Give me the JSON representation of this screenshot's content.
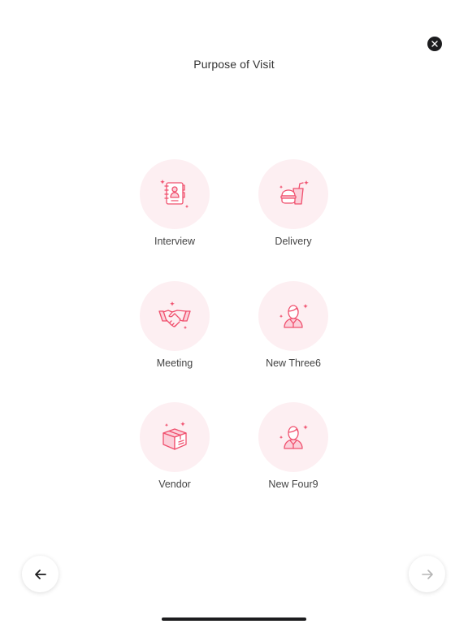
{
  "header": {
    "title": "Purpose of Visit",
    "close_icon": "close-icon"
  },
  "options": [
    {
      "label": "Interview",
      "icon": "contact-book-icon"
    },
    {
      "label": "Delivery",
      "icon": "food-delivery-icon"
    },
    {
      "label": "Meeting",
      "icon": "handshake-icon"
    },
    {
      "label": "New Three6",
      "icon": "person-icon"
    },
    {
      "label": "Vendor",
      "icon": "package-box-icon"
    },
    {
      "label": "New Four9",
      "icon": "person-icon"
    }
  ],
  "navigation": {
    "back_icon": "arrow-left-icon",
    "next_icon": "arrow-right-icon"
  },
  "colors": {
    "accent": "#f0506e",
    "circle_bg": "#fdeff2",
    "text": "#333333",
    "next_disabled": "#b5b5b5"
  }
}
